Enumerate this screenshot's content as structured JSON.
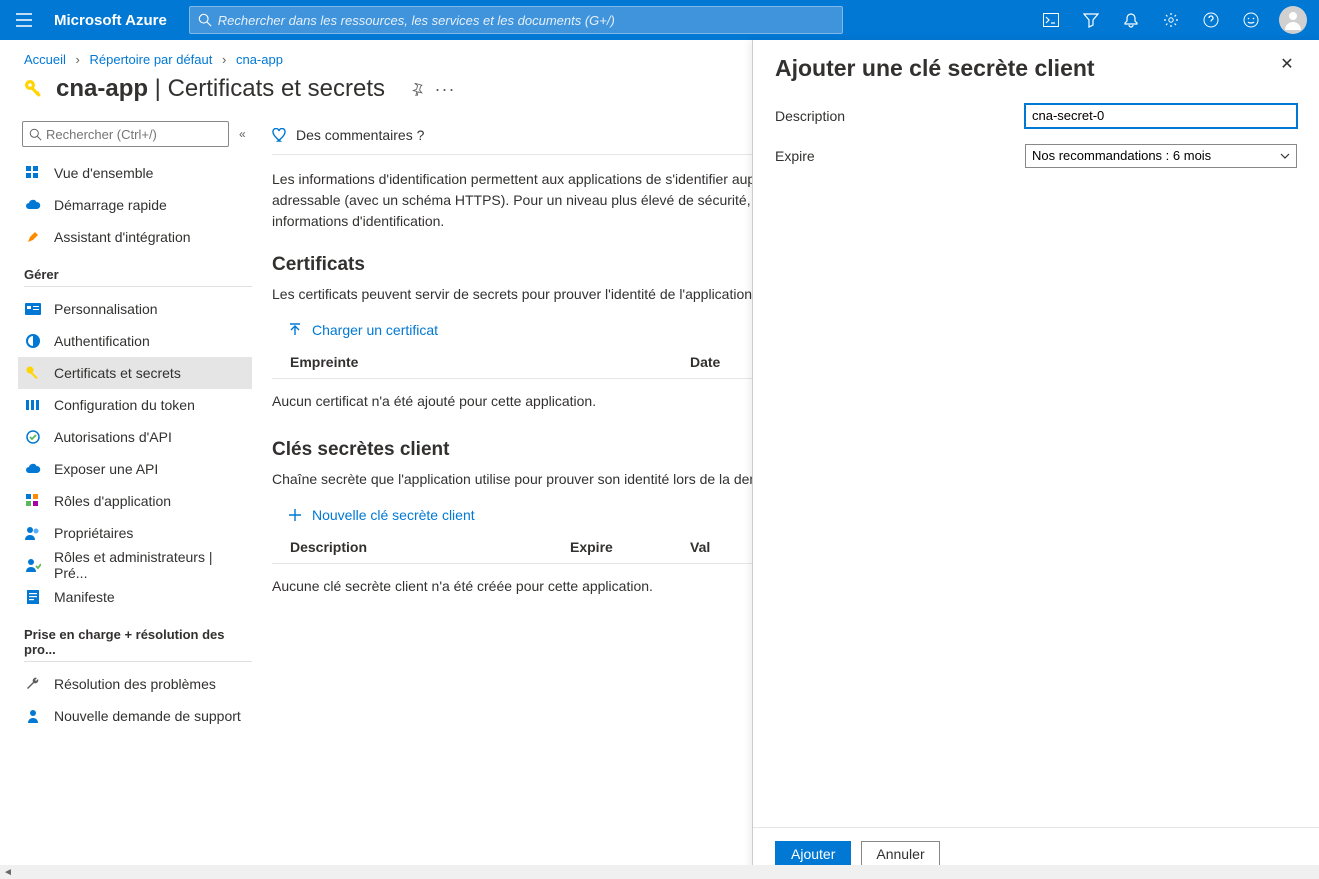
{
  "topbar": {
    "brand": "Microsoft Azure",
    "search_placeholder": "Rechercher dans les ressources, les services et les documents (G+/)"
  },
  "breadcrumb": {
    "home": "Accueil",
    "dir": "Répertoire par défaut",
    "app": "cna-app"
  },
  "header": {
    "title_prefix": "cna-app",
    "title_sep": " | ",
    "title_suffix": "Certificats et secrets"
  },
  "sidebar": {
    "search_placeholder": "Rechercher (Ctrl+/)",
    "items_top": [
      {
        "label": "Vue d'ensemble"
      },
      {
        "label": "Démarrage rapide"
      },
      {
        "label": "Assistant d'intégration"
      }
    ],
    "section_manage": "Gérer",
    "items_manage": [
      {
        "label": "Personnalisation"
      },
      {
        "label": "Authentification"
      },
      {
        "label": "Certificats et secrets",
        "active": true
      },
      {
        "label": "Configuration du token"
      },
      {
        "label": "Autorisations d'API"
      },
      {
        "label": "Exposer une API"
      },
      {
        "label": "Rôles d'application"
      },
      {
        "label": "Propriétaires"
      },
      {
        "label": "Rôles et administrateurs | Pré..."
      },
      {
        "label": "Manifeste"
      }
    ],
    "section_support": "Prise en charge + résolution des pro...",
    "items_support": [
      {
        "label": "Résolution des problèmes"
      },
      {
        "label": "Nouvelle demande de support"
      }
    ]
  },
  "main": {
    "feedback": "Des commentaires ?",
    "info_text": "Les informations d'identification permettent aux applications de s'identifier auprès du service d'authentification lors de la réception de jetons à un emplacement web adressable (avec un schéma HTTPS). Pour un niveau plus élevé de sécurité, nous vous recommandons d'utiliser un certificat (au lieu d'un secret client) comme informations d'identification.",
    "cert_heading": "Certificats",
    "cert_p": "Les certificats peuvent servir de secrets pour prouver l'identité de l'application lors de la demande de jeton. Également appelés clés publiques.",
    "cert_upload": "Charger un certificat",
    "cert_col1": "Empreinte",
    "cert_col2": "Date",
    "cert_empty": "Aucun certificat n'a été ajouté pour cette application.",
    "secret_heading": "Clés secrètes client",
    "secret_p": "Chaîne secrète que l'application utilise pour prouver son identité lors de la demande d'un jeton. Également appelée mot de passe de l'application.",
    "secret_new": "Nouvelle clé secrète client",
    "secret_col1": "Description",
    "secret_col2": "Expire",
    "secret_col3": "Val",
    "secret_empty": "Aucune clé secrète client n'a été créée pour cette application."
  },
  "flyout": {
    "title": "Ajouter une clé secrète client",
    "desc_label": "Description",
    "desc_value": "cna-secret-0",
    "expire_label": "Expire",
    "expire_value": "Nos recommandations : 6 mois",
    "add": "Ajouter",
    "cancel": "Annuler"
  }
}
